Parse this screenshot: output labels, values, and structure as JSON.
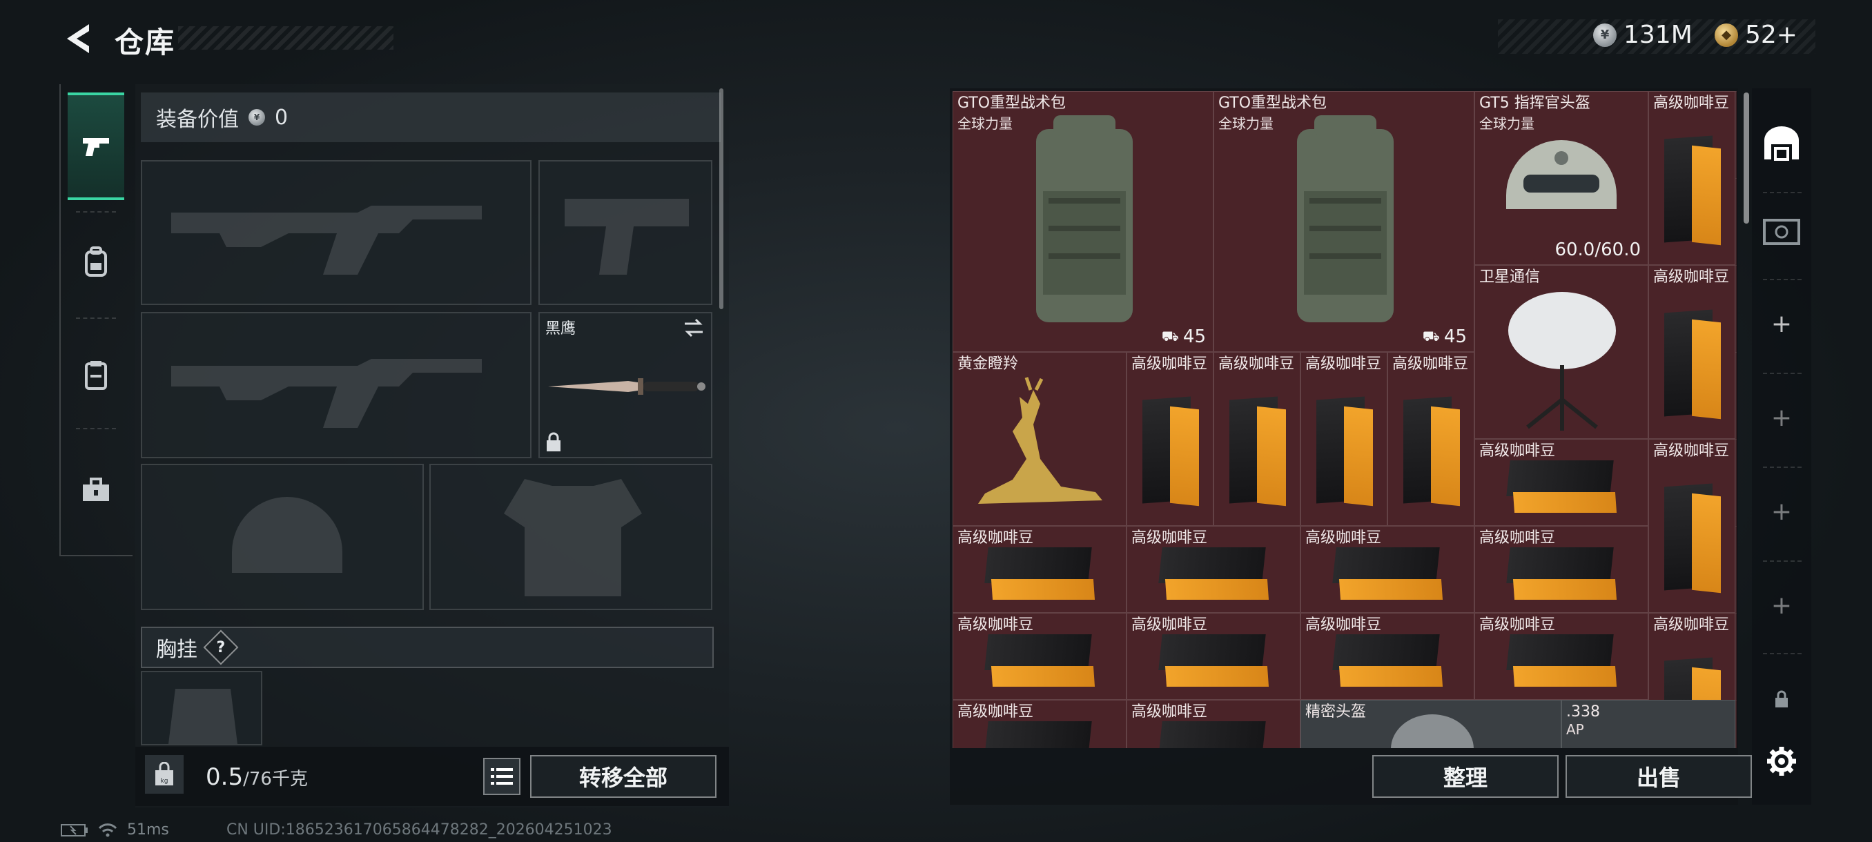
{
  "header": {
    "title": "仓库",
    "currencies": [
      {
        "icon": "silver-coin-icon",
        "value": "131M"
      },
      {
        "icon": "gold-coin-icon",
        "value": "52+"
      }
    ]
  },
  "left_nav": [
    "pistol-icon",
    "backpack-icon",
    "rig-icon",
    "toolbox-icon"
  ],
  "equipment": {
    "value_label": "装备价值",
    "value": "0",
    "melee_name": "黑鹰",
    "chest_label": "胸挂",
    "help_glyph": "?",
    "weight_current": "0.5",
    "weight_max": "/76千克",
    "transfer_all": "转移全部"
  },
  "stash": {
    "items": [
      {
        "name": "GTO重型战术包",
        "sub": "全球力量",
        "qty": "45"
      },
      {
        "name": "GTO重型战术包",
        "sub": "全球力量",
        "qty": "45"
      },
      {
        "name": "GT5 指挥官头盔",
        "sub": "全球力量",
        "durability": "60.0/60.0"
      },
      {
        "name": "卫星通信"
      },
      {
        "name": "黄金瞪羚"
      },
      {
        "name": "精密头盔"
      },
      {
        "name": ".338",
        "sub": "AP"
      }
    ],
    "coffee_label": "高级咖啡豆",
    "organize": "整理",
    "sell": "出售"
  },
  "status": {
    "ping": "51ms",
    "uid": "CN UID:18652361706586447828​2_202604251023"
  },
  "colors": {
    "accent_green": "#3ad6a3",
    "stash_cell": "#4a2328"
  }
}
